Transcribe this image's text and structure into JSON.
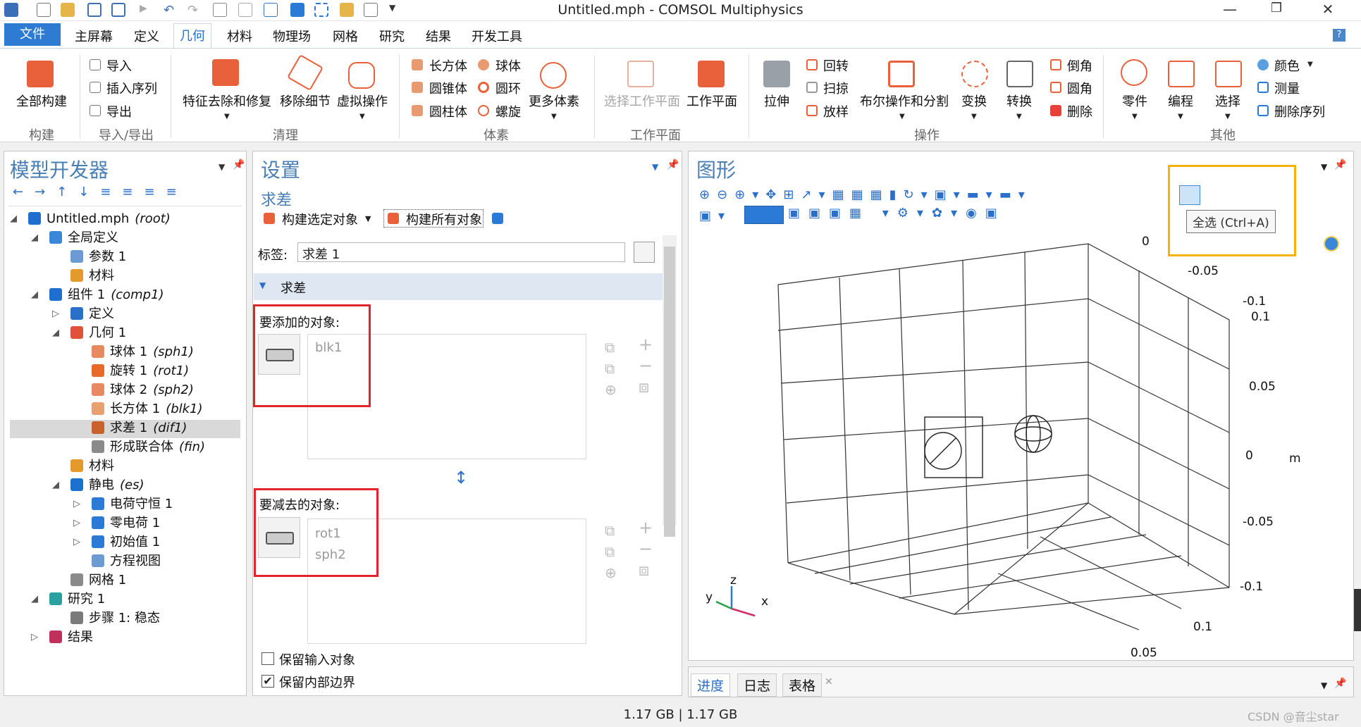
{
  "window": {
    "title": "Untitled.mph - COMSOL Multiphysics",
    "controls": {
      "minimize": "—",
      "restore": "❐",
      "close": "✕"
    }
  },
  "menu": {
    "items": [
      "文件",
      "主屏幕",
      "定义",
      "几何",
      "材料",
      "物理场",
      "网格",
      "研究",
      "结果",
      "开发工具"
    ],
    "active": "几何",
    "help": "?"
  },
  "ribbon": {
    "build_all": "全部构建",
    "import": "导入",
    "insert_sequence": "插入序列",
    "export": "导出",
    "defeaturing": "特征去除和修复",
    "remove_details": "移除细节",
    "virtual_ops": "虚拟操作",
    "block": "长方体",
    "cone": "圆锥体",
    "cylinder": "圆柱体",
    "sphere": "球体",
    "torus": "圆环",
    "helix": "螺旋",
    "more_primitives": "更多体素",
    "select_workplane": "选择工作平面",
    "workplane": "工作平面",
    "extrude": "拉伸",
    "revolve": "回转",
    "sweep": "扫掠",
    "loft": "放样",
    "booleans": "布尔操作和分割",
    "transforms": "变换",
    "conversions": "转换",
    "chamfer": "倒角",
    "fillet": "圆角",
    "delete": "删除",
    "parts": "零件",
    "programming": "编程",
    "selections": "选择",
    "color": "颜色",
    "measure": "测量",
    "delete_sequence": "删除序列",
    "groups": [
      "构建",
      "导入/导出",
      "清理",
      "体素",
      "工作平面",
      "操作",
      "其他"
    ]
  },
  "model_builder": {
    "title": "模型开发器",
    "tree": [
      {
        "label": "Untitled.mph",
        "tag": "(root)",
        "icon": "model-icon",
        "color": "#1e6fd0"
      },
      {
        "label": "全局定义",
        "tag": "",
        "icon": "globe-icon",
        "color": "#3a86d9"
      },
      {
        "label": "参数 1",
        "tag": "",
        "icon": "parameters-icon",
        "color": "#6b9bd2"
      },
      {
        "label": "材料",
        "tag": "",
        "icon": "materials-icon",
        "color": "#e39a2b"
      },
      {
        "label": "组件 1",
        "tag": "(comp1)",
        "icon": "component-icon",
        "color": "#1e6fd0"
      },
      {
        "label": "定义",
        "tag": "",
        "icon": "definitions-icon",
        "color": "#2a6fc9"
      },
      {
        "label": "几何 1",
        "tag": "",
        "icon": "geometry-icon",
        "color": "#e0533a"
      },
      {
        "label": "球体 1",
        "tag": "(sph1)",
        "icon": "sphere-icon",
        "color": "#e88a60"
      },
      {
        "label": "旋转 1",
        "tag": "(rot1)",
        "icon": "rotate-icon",
        "color": "#e86a2a"
      },
      {
        "label": "球体 2",
        "tag": "(sph2)",
        "icon": "sphere-icon",
        "color": "#e88a60"
      },
      {
        "label": "长方体 1",
        "tag": "(blk1)",
        "icon": "block-icon",
        "color": "#e8a070"
      },
      {
        "label": "求差 1",
        "tag": "(dif1)",
        "icon": "difference-icon",
        "color": "#c9612c"
      },
      {
        "label": "形成联合体",
        "tag": "(fin)",
        "icon": "form-union-icon",
        "color": "#8a8a8a"
      },
      {
        "label": "材料",
        "tag": "",
        "icon": "materials-icon",
        "color": "#e39a2b"
      },
      {
        "label": "静电",
        "tag": "(es)",
        "icon": "electrostatics-icon",
        "color": "#1e6fd0"
      },
      {
        "label": "电荷守恒 1",
        "tag": "",
        "icon": "domain-icon",
        "color": "#2a7ad6"
      },
      {
        "label": "零电荷 1",
        "tag": "",
        "icon": "boundary-icon",
        "color": "#2a7ad6"
      },
      {
        "label": "初始值 1",
        "tag": "",
        "icon": "init-icon",
        "color": "#2a7ad6"
      },
      {
        "label": "方程视图",
        "tag": "",
        "icon": "equation-icon",
        "color": "#6b9bd2"
      },
      {
        "label": "网格 1",
        "tag": "",
        "icon": "mesh-icon",
        "color": "#8a8a8a"
      },
      {
        "label": "研究 1",
        "tag": "",
        "icon": "study-icon",
        "color": "#2aa0a0"
      },
      {
        "label": "步骤 1: 稳态",
        "tag": "",
        "icon": "step-icon",
        "color": "#7a7a7a"
      },
      {
        "label": "结果",
        "tag": "",
        "icon": "results-icon",
        "color": "#c0305a"
      }
    ]
  },
  "settings": {
    "title": "设置",
    "subtitle": "求差",
    "build_selected": "构建选定对象",
    "build_all": "构建所有对象",
    "label_caption": "标签:",
    "label_value": "求差 1",
    "section": "求差",
    "objects_add_caption": "要添加的对象:",
    "objects_add": [
      "blk1"
    ],
    "objects_subtract_caption": "要减去的对象:",
    "objects_subtract": [
      "rot1",
      "sph2"
    ],
    "keep_input_label": "保留输入对象",
    "keep_input": false,
    "keep_interior_label": "保留内部边界",
    "keep_interior": true
  },
  "graphics": {
    "title": "图形",
    "tooltip": "全选 (Ctrl+A)",
    "axis_labels": {
      "a": "0",
      "b": "-0.05",
      "c": "-0.1",
      "d": "0.1",
      "e": "0.05",
      "f": "0",
      "g": "-0.05",
      "h": "-0.1",
      "i": "0.1",
      "j": "0.05",
      "m": "m"
    },
    "triad": {
      "x": "x",
      "y": "y",
      "z": "z"
    }
  },
  "bottom_tabs": [
    "进度",
    "日志",
    "表格"
  ],
  "status": {
    "memory": "1.17 GB | 1.17 GB",
    "watermark": "CSDN @音尘star"
  }
}
